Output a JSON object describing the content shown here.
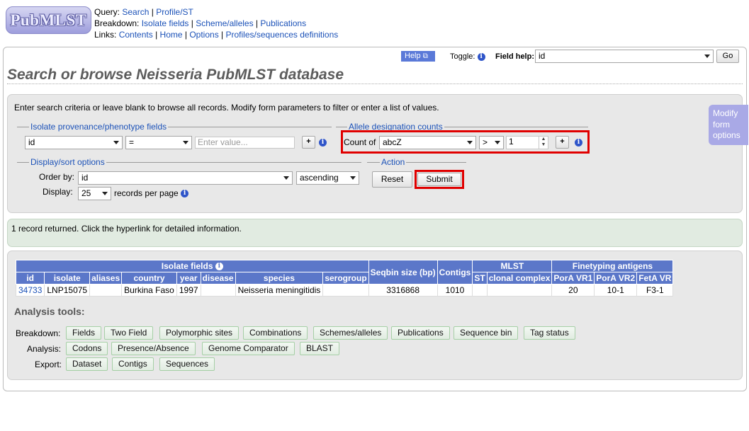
{
  "header": {
    "logo": "PubMLST",
    "query_label": "Query:",
    "query_links": [
      "Search",
      "Profile/ST"
    ],
    "breakdown_label": "Breakdown:",
    "breakdown_links": [
      "Isolate fields",
      "Scheme/alleles",
      "Publications"
    ],
    "links_label": "Links:",
    "links_links": [
      "Contents",
      "Home",
      "Options",
      "Profiles/sequences definitions"
    ]
  },
  "toolbar": {
    "help_label": "Help",
    "toggle_label": "Toggle:",
    "field_help_label": "Field help:",
    "field_help_value": "id",
    "go_label": "Go"
  },
  "page_title": "Search or browse Neisseria PubMLST database",
  "search_form": {
    "intro": "Enter search criteria or leave blank to browse all records. Modify form parameters to filter or enter a list of values.",
    "provenance": {
      "legend": "Isolate provenance/phenotype fields",
      "field": "id",
      "operator": "=",
      "value_placeholder": "Enter value..."
    },
    "allele_counts": {
      "legend": "Allele designation counts",
      "count_of_label": "Count of",
      "locus": "abcZ",
      "operator": ">",
      "value": "1"
    },
    "display": {
      "legend": "Display/sort options",
      "order_by_label": "Order by:",
      "order_by_value": "id",
      "direction": "ascending",
      "display_label": "Display:",
      "per_page_value": "25",
      "per_page_suffix": "records per page"
    },
    "action": {
      "legend": "Action",
      "reset_label": "Reset",
      "submit_label": "Submit"
    },
    "modify_tab": [
      "Modify",
      "form",
      "options"
    ]
  },
  "results": {
    "message": "1 record returned. Click the hyperlink for detailed information.",
    "group_headers": {
      "isolate_fields": "Isolate fields",
      "seqbin": "Seqbin size (bp)",
      "contigs": "Contigs",
      "mlst": "MLST",
      "finetyping": "Finetyping antigens"
    },
    "columns": [
      "id",
      "isolate",
      "aliases",
      "country",
      "year",
      "disease",
      "species",
      "serogroup",
      "ST",
      "clonal complex",
      "PorA VR1",
      "PorA VR2",
      "FetA VR"
    ],
    "row": {
      "id": "34733",
      "isolate": "LNP15075",
      "aliases": "",
      "country": "Burkina Faso",
      "year": "1997",
      "disease": "",
      "species": "Neisseria meningitidis",
      "serogroup": "",
      "seqbin": "3316868",
      "contigs": "1010",
      "st": "",
      "clonal_complex": "",
      "pora_vr1": "20",
      "pora_vr2": "10-1",
      "feta_vr": "F3-1"
    }
  },
  "analysis_tools": {
    "heading": "Analysis tools:",
    "breakdown_label": "Breakdown:",
    "breakdown": [
      "Fields",
      "Two Field",
      "Polymorphic sites",
      "Combinations",
      "Schemes/alleles",
      "Publications",
      "Sequence bin",
      "Tag status"
    ],
    "analysis_label": "Analysis:",
    "analysis": [
      "Codons",
      "Presence/Absence",
      "Genome Comparator",
      "BLAST"
    ],
    "export_label": "Export:",
    "export": [
      "Dataset",
      "Contigs",
      "Sequences"
    ]
  },
  "colors": {
    "link": "#1c52b8",
    "table_header": "#5b77c9",
    "highlight": "#e00000",
    "results_box": "#e1ebe1"
  }
}
